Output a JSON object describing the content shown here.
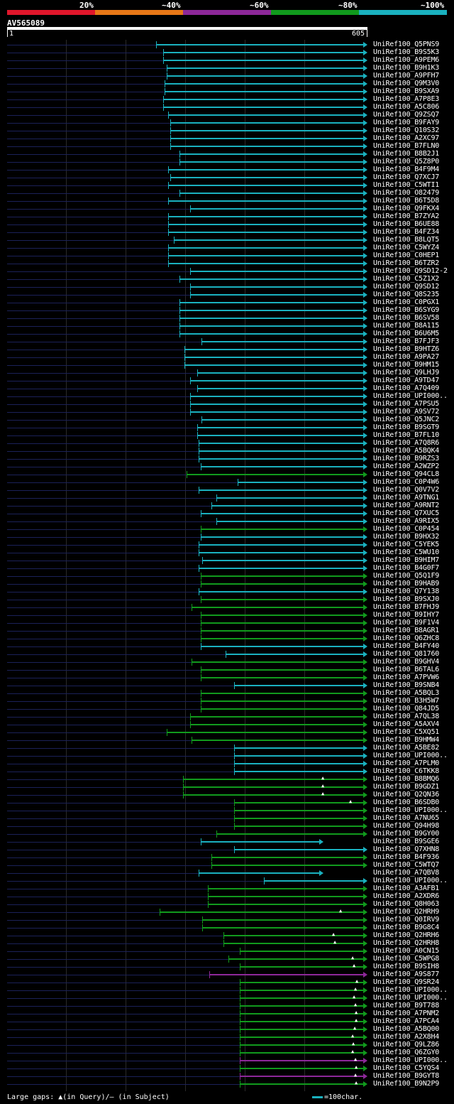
{
  "legend": {
    "labels": [
      "20%",
      "~40%",
      "~60%",
      "~80%",
      "~100%"
    ],
    "colors": [
      "#e0162b",
      "#e77817",
      "#8d2899",
      "#119a1d",
      "#1ab1bf"
    ]
  },
  "query": {
    "name": "AV565089",
    "start": "1",
    "end": "605"
  },
  "footer": {
    "gaps_text": "Large gaps: ▲(in Query)/– (in Subject)",
    "scale_text": "=100char."
  },
  "hits": [
    {
      "name": "UniRef100_Q5PNS9",
      "start": 220,
      "color": "#1ab1bf",
      "arrow": true
    },
    {
      "name": "UniRef100_B9S5K3",
      "start": 230,
      "color": "#1ab1bf",
      "arrow": true
    },
    {
      "name": "UniRef100_A9PEM6",
      "start": 230,
      "color": "#1ab1bf",
      "arrow": true
    },
    {
      "name": "UniRef100_B9H1K3",
      "start": 235,
      "color": "#1ab1bf",
      "arrow": true
    },
    {
      "name": "UniRef100_A9PFH7",
      "start": 235,
      "color": "#1ab1bf",
      "arrow": true
    },
    {
      "name": "UniRef100_Q9M3V0",
      "start": 232,
      "color": "#1ab1bf",
      "arrow": true
    },
    {
      "name": "UniRef100_B9SXA9",
      "start": 232,
      "color": "#1ab1bf",
      "arrow": true
    },
    {
      "name": "UniRef100_A7P8E3",
      "start": 230,
      "color": "#1ab1bf",
      "arrow": true
    },
    {
      "name": "UniRef100_A5C806",
      "start": 230,
      "color": "#1ab1bf",
      "arrow": true
    },
    {
      "name": "UniRef100_Q9ZSQ7",
      "start": 237,
      "color": "#1ab1bf",
      "arrow": true
    },
    {
      "name": "UniRef100_B9FAY9",
      "start": 240,
      "color": "#1ab1bf",
      "arrow": true
    },
    {
      "name": "UniRef100_Q10S32",
      "start": 240,
      "color": "#1ab1bf",
      "arrow": true
    },
    {
      "name": "UniRef100_A2XC97",
      "start": 240,
      "color": "#1ab1bf",
      "arrow": true
    },
    {
      "name": "UniRef100_B7FLN0",
      "start": 240,
      "color": "#1ab1bf",
      "arrow": true
    },
    {
      "name": "UniRef100_B8B2J1",
      "start": 253,
      "color": "#1ab1bf",
      "arrow": true
    },
    {
      "name": "UniRef100_Q5Z8P0",
      "start": 253,
      "color": "#1ab1bf",
      "arrow": true
    },
    {
      "name": "UniRef100_B4F9M4",
      "start": 237,
      "color": "#1ab1bf",
      "arrow": true
    },
    {
      "name": "UniRef100_Q7XCJ7",
      "start": 240,
      "color": "#1ab1bf",
      "arrow": true
    },
    {
      "name": "UniRef100_C5WTI1",
      "start": 237,
      "color": "#1ab1bf",
      "arrow": true
    },
    {
      "name": "UniRef100_O82479",
      "start": 253,
      "color": "#1ab1bf",
      "arrow": true
    },
    {
      "name": "UniRef100_B6T5D8",
      "start": 237,
      "color": "#1ab1bf",
      "arrow": true
    },
    {
      "name": "UniRef100_Q9FKX4",
      "start": 268,
      "color": "#1ab1bf",
      "arrow": true
    },
    {
      "name": "UniRef100_B7ZYA2",
      "start": 237,
      "color": "#1ab1bf",
      "arrow": true
    },
    {
      "name": "UniRef100_B6UE88",
      "start": 237,
      "color": "#1ab1bf",
      "arrow": true
    },
    {
      "name": "UniRef100_B4FZ34",
      "start": 237,
      "color": "#1ab1bf",
      "arrow": true
    },
    {
      "name": "UniRef100_B8LQT5",
      "start": 245,
      "color": "#1ab1bf",
      "arrow": true
    },
    {
      "name": "UniRef100_C5WYZ4",
      "start": 237,
      "color": "#1ab1bf",
      "arrow": true
    },
    {
      "name": "UniRef100_C0HEP1",
      "start": 237,
      "color": "#1ab1bf",
      "arrow": true
    },
    {
      "name": "UniRef100_B6TZR2",
      "start": 237,
      "color": "#1ab1bf",
      "arrow": true
    },
    {
      "name": "UniRef100_Q9SD12-2",
      "start": 268,
      "color": "#1ab1bf",
      "arrow": true
    },
    {
      "name": "UniRef100_C5Z1X2",
      "start": 253,
      "color": "#1ab1bf",
      "arrow": true
    },
    {
      "name": "UniRef100_Q9SD12",
      "start": 268,
      "color": "#1ab1bf",
      "arrow": true
    },
    {
      "name": "UniRef100_Q8S235",
      "start": 268,
      "color": "#1ab1bf",
      "arrow": true
    },
    {
      "name": "UniRef100_C0PGX1",
      "start": 253,
      "color": "#1ab1bf",
      "arrow": true
    },
    {
      "name": "UniRef100_B6SYG9",
      "start": 253,
      "color": "#1ab1bf",
      "arrow": true
    },
    {
      "name": "UniRef100_B6SV58",
      "start": 253,
      "color": "#1ab1bf",
      "arrow": true
    },
    {
      "name": "UniRef100_B8A115",
      "start": 253,
      "color": "#1ab1bf",
      "arrow": true
    },
    {
      "name": "UniRef100_B6U6M5",
      "start": 253,
      "color": "#1ab1bf",
      "arrow": true
    },
    {
      "name": "UniRef100_B7FJF3",
      "start": 284,
      "color": "#1ab1bf",
      "arrow": true
    },
    {
      "name": "UniRef100_B9HTZ6",
      "start": 260,
      "color": "#1ab1bf",
      "arrow": true
    },
    {
      "name": "UniRef100_A9PA27",
      "start": 260,
      "color": "#1ab1bf",
      "arrow": true
    },
    {
      "name": "UniRef100_B9HM15",
      "start": 260,
      "color": "#1ab1bf",
      "arrow": true
    },
    {
      "name": "UniRef100_Q9LHJ9",
      "start": 278,
      "color": "#1ab1bf",
      "arrow": true
    },
    {
      "name": "UniRef100_A9TD47",
      "start": 268,
      "color": "#1ab1bf",
      "arrow": true
    },
    {
      "name": "UniRef100_A7Q409",
      "start": 278,
      "color": "#1ab1bf",
      "arrow": true
    },
    {
      "name": "UniRef100_UPI000..",
      "start": 268,
      "color": "#1ab1bf",
      "arrow": true
    },
    {
      "name": "UniRef100_A7PSU5",
      "start": 268,
      "color": "#1ab1bf",
      "arrow": true
    },
    {
      "name": "UniRef100_A9SV72",
      "start": 268,
      "color": "#1ab1bf",
      "arrow": true
    },
    {
      "name": "UniRef100_Q5JNC2",
      "start": 284,
      "color": "#1ab1bf",
      "arrow": true
    },
    {
      "name": "UniRef100_B9SGT9",
      "start": 278,
      "color": "#1ab1bf",
      "arrow": true
    },
    {
      "name": "UniRef100_B7FL10",
      "start": 278,
      "color": "#1ab1bf",
      "arrow": true
    },
    {
      "name": "UniRef100_A7Q8R6",
      "start": 280,
      "color": "#1ab1bf",
      "arrow": true
    },
    {
      "name": "UniRef100_A5BQK4",
      "start": 280,
      "color": "#1ab1bf",
      "arrow": true
    },
    {
      "name": "UniRef100_B9RZS3",
      "start": 280,
      "color": "#1ab1bf",
      "arrow": true
    },
    {
      "name": "UniRef100_A2WZP2",
      "start": 283,
      "color": "#1ab1bf",
      "arrow": true
    },
    {
      "name": "UniRef100_Q94CL8",
      "start": 263,
      "color": "#119a1d",
      "arrow": true
    },
    {
      "name": "UniRef100_C0P4W6",
      "start": 335,
      "color": "#1ab1bf",
      "arrow": true
    },
    {
      "name": "UniRef100_Q0V7V2",
      "start": 280,
      "color": "#1ab1bf",
      "arrow": true
    },
    {
      "name": "UniRef100_A9TNG1",
      "start": 305,
      "color": "#1ab1bf",
      "arrow": true
    },
    {
      "name": "UniRef100_A9RNT2",
      "start": 298,
      "color": "#1ab1bf",
      "arrow": true
    },
    {
      "name": "UniRef100_Q7XUC5",
      "start": 283,
      "color": "#1ab1bf",
      "arrow": true
    },
    {
      "name": "UniRef100_A9RIX5",
      "start": 305,
      "color": "#1ab1bf",
      "arrow": true
    },
    {
      "name": "UniRef100_C0P454",
      "start": 283,
      "color": "#119a1d",
      "arrow": true
    },
    {
      "name": "UniRef100_B9HX32",
      "start": 283,
      "color": "#1ab1bf",
      "arrow": true
    },
    {
      "name": "UniRef100_C5YEK5",
      "start": 280,
      "color": "#1ab1bf",
      "arrow": true
    },
    {
      "name": "UniRef100_C5WU10",
      "start": 280,
      "color": "#1ab1bf",
      "arrow": true
    },
    {
      "name": "UniRef100_B9HIM7",
      "start": 285,
      "color": "#1ab1bf",
      "arrow": true
    },
    {
      "name": "UniRef100_B4G0F7",
      "start": 280,
      "color": "#1ab1bf",
      "arrow": true
    },
    {
      "name": "UniRef100_Q5Q1F9",
      "start": 283,
      "color": "#119a1d",
      "arrow": true
    },
    {
      "name": "UniRef100_B9HAB9",
      "start": 283,
      "color": "#119a1d",
      "arrow": true
    },
    {
      "name": "UniRef100_Q7Y138",
      "start": 280,
      "color": "#1ab1bf",
      "arrow": true
    },
    {
      "name": "UniRef100_B9SXJ0",
      "start": 283,
      "color": "#119a1d",
      "arrow": true
    },
    {
      "name": "UniRef100_B7FHJ9",
      "start": 270,
      "color": "#119a1d",
      "arrow": true
    },
    {
      "name": "UniRef100_B9IHY7",
      "start": 283,
      "color": "#119a1d",
      "arrow": true
    },
    {
      "name": "UniRef100_B9F1V4",
      "start": 283,
      "color": "#119a1d",
      "arrow": true
    },
    {
      "name": "UniRef100_B8AGR1",
      "start": 283,
      "color": "#119a1d",
      "arrow": true
    },
    {
      "name": "UniRef100_Q6ZHC8",
      "start": 283,
      "color": "#119a1d",
      "arrow": true
    },
    {
      "name": "UniRef100_B4FY40",
      "start": 283,
      "color": "#1ab1bf",
      "arrow": true
    },
    {
      "name": "UniRef100_Q81760",
      "start": 318,
      "color": "#1ab1bf",
      "arrow": true
    },
    {
      "name": "UniRef100_B9GHV4",
      "start": 270,
      "color": "#119a1d",
      "arrow": true
    },
    {
      "name": "UniRef100_B6TAL6",
      "start": 283,
      "color": "#119a1d",
      "arrow": true
    },
    {
      "name": "UniRef100_A7PVW6",
      "start": 283,
      "color": "#119a1d",
      "arrow": true
    },
    {
      "name": "UniRef100_B9SNB4",
      "start": 330,
      "color": "#1ab1bf",
      "arrow": true
    },
    {
      "name": "UniRef100_A5BQL3",
      "start": 283,
      "color": "#119a1d",
      "arrow": true
    },
    {
      "name": "UniRef100_B3H5W7",
      "start": 283,
      "color": "#119a1d",
      "arrow": true
    },
    {
      "name": "UniRef100_Q84JD5",
      "start": 283,
      "color": "#119a1d",
      "arrow": true
    },
    {
      "name": "UniRef100_A7QL38",
      "start": 268,
      "color": "#119a1d",
      "arrow": true
    },
    {
      "name": "UniRef100_A5AXV4",
      "start": 268,
      "color": "#119a1d",
      "arrow": true
    },
    {
      "name": "UniRef100_C5XQ51",
      "start": 235,
      "color": "#119a1d",
      "arrow": true
    },
    {
      "name": "UniRef100_B9HMW4",
      "start": 270,
      "color": "#119a1d",
      "arrow": true
    },
    {
      "name": "UniRef100_A5BE82",
      "start": 330,
      "color": "#1ab1bf",
      "arrow": true
    },
    {
      "name": "UniRef100_UPI000..",
      "start": 330,
      "color": "#1ab1bf",
      "arrow": true
    },
    {
      "name": "UniRef100_A7PLM0",
      "start": 330,
      "color": "#1ab1bf",
      "arrow": true
    },
    {
      "name": "UniRef100_C6TKK8",
      "start": 330,
      "color": "#1ab1bf",
      "arrow": true
    },
    {
      "name": "UniRef100_B8BMQ6",
      "start": 258,
      "color": "#119a1d",
      "arrow": true,
      "gap": 455
    },
    {
      "name": "UniRef100_B9GDZ1",
      "start": 258,
      "color": "#119a1d",
      "arrow": true,
      "gap": 455
    },
    {
      "name": "UniRef100_Q2QN36",
      "start": 258,
      "color": "#119a1d",
      "arrow": true,
      "gap": 455
    },
    {
      "name": "UniRef100_B6SDB0",
      "start": 330,
      "color": "#119a1d",
      "arrow": true,
      "gap": 494
    },
    {
      "name": "UniRef100_UPI000..",
      "start": 330,
      "color": "#119a1d",
      "arrow": true
    },
    {
      "name": "UniRef100_A7NU65",
      "start": 330,
      "color": "#119a1d",
      "arrow": true
    },
    {
      "name": "UniRef100_Q94H98",
      "start": 330,
      "color": "#119a1d",
      "arrow": true
    },
    {
      "name": "UniRef100_B9GY00",
      "start": 305,
      "color": "#119a1d",
      "arrow": true
    },
    {
      "name": "UniRef100_B9SGE6",
      "start": 283,
      "color": "#1ab1bf",
      "arrow": true,
      "end": 450
    },
    {
      "name": "UniRef100_Q7XHN8",
      "start": 330,
      "color": "#1ab1bf",
      "arrow": true
    },
    {
      "name": "UniRef100_B4F936",
      "start": 298,
      "color": "#119a1d",
      "arrow": true
    },
    {
      "name": "UniRef100_C5WTQ7",
      "start": 298,
      "color": "#119a1d",
      "arrow": true
    },
    {
      "name": "UniRef100_A7QBV8",
      "start": 280,
      "color": "#1ab1bf",
      "arrow": true,
      "end": 450
    },
    {
      "name": "UniRef100_UPI000..",
      "start": 372,
      "color": "#1ab1bf",
      "arrow": true
    },
    {
      "name": "UniRef100_A3AFB1",
      "start": 293,
      "color": "#119a1d",
      "arrow": true
    },
    {
      "name": "UniRef100_A2XDR6",
      "start": 293,
      "color": "#119a1d",
      "arrow": true
    },
    {
      "name": "UniRef100_Q8H063",
      "start": 293,
      "color": "#119a1d",
      "arrow": true
    },
    {
      "name": "UniRef100_Q2HRH9",
      "start": 225,
      "color": "#119a1d",
      "arrow": true,
      "gap": 480
    },
    {
      "name": "UniRef100_Q0IRV9",
      "start": 285,
      "color": "#119a1d",
      "arrow": true
    },
    {
      "name": "UniRef100_B9G8C4",
      "start": 285,
      "color": "#119a1d",
      "arrow": true
    },
    {
      "name": "UniRef100_Q2HRH6",
      "start": 315,
      "color": "#119a1d",
      "arrow": true,
      "gap": 470
    },
    {
      "name": "UniRef100_Q2HRH8",
      "start": 315,
      "color": "#119a1d",
      "arrow": true,
      "gap": 472
    },
    {
      "name": "UniRef100_A0CN15",
      "start": 338,
      "color": "#119a1d",
      "arrow": true
    },
    {
      "name": "UniRef100_C5WPG8",
      "start": 322,
      "color": "#119a1d",
      "arrow": true,
      "gap": 497
    },
    {
      "name": "UniRef100_B9SIH8",
      "start": 338,
      "color": "#119a1d",
      "arrow": true,
      "gap": 499
    },
    {
      "name": "UniRef100_A9S877",
      "start": 295,
      "color": "#8d2899",
      "arrow": true
    },
    {
      "name": "UniRef100_Q9SR24",
      "start": 338,
      "color": "#119a1d",
      "arrow": true,
      "gap": 503
    },
    {
      "name": "UniRef100_UPI000..",
      "start": 338,
      "color": "#119a1d",
      "arrow": true,
      "gap": 501
    },
    {
      "name": "UniRef100_UPI000..",
      "start": 338,
      "color": "#119a1d",
      "arrow": true,
      "gap": 499
    },
    {
      "name": "UniRef100_B9T788",
      "start": 338,
      "color": "#119a1d",
      "arrow": true,
      "gap": 501
    },
    {
      "name": "UniRef100_A7PNM2",
      "start": 338,
      "color": "#119a1d",
      "arrow": true,
      "gap": 502
    },
    {
      "name": "UniRef100_A7PCA4",
      "start": 338,
      "color": "#119a1d",
      "arrow": true,
      "gap": 502
    },
    {
      "name": "UniRef100_A5BQ00",
      "start": 338,
      "color": "#119a1d",
      "arrow": true,
      "gap": 500
    },
    {
      "name": "UniRef100_A2X8H4",
      "start": 338,
      "color": "#119a1d",
      "arrow": true,
      "gap": 497
    },
    {
      "name": "UniRef100_Q9LZ86",
      "start": 338,
      "color": "#119a1d",
      "arrow": true,
      "gap": 498
    },
    {
      "name": "UniRef100_Q6ZGY0",
      "start": 338,
      "color": "#119a1d",
      "arrow": true,
      "gap": 497
    },
    {
      "name": "UniRef100_UPI000..",
      "start": 338,
      "color": "#8d2899",
      "arrow": true,
      "gap": 501
    },
    {
      "name": "UniRef100_C5YQS4",
      "start": 338,
      "color": "#119a1d",
      "arrow": true,
      "gap": 502
    },
    {
      "name": "UniRef100_B9GYT8",
      "start": 338,
      "color": "#8d2899",
      "arrow": true,
      "gap": 501
    },
    {
      "name": "UniRef100_B9N2P9",
      "start": 338,
      "color": "#119a1d",
      "arrow": true,
      "gap": 502
    }
  ]
}
